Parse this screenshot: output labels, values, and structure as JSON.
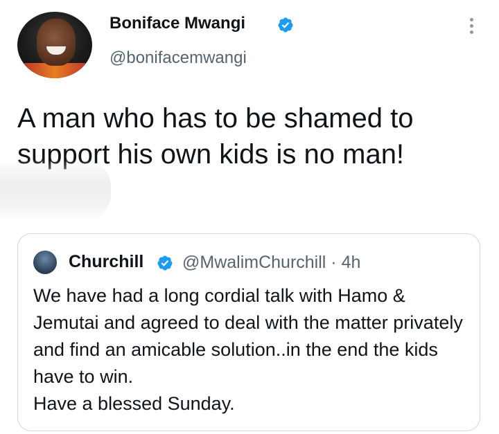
{
  "tweet": {
    "author": {
      "name": "Boniface Mwangi",
      "handle": "@bonifacemwangi",
      "verified": true
    },
    "text": "A man who has to be shamed to support his own kids is no man!"
  },
  "quoted_tweet": {
    "author": {
      "name": "Churchill",
      "handle": "@MwalimChurchill",
      "verified": true
    },
    "meta": "@MwalimChurchill · 4h",
    "text": "We have had a long cordial talk with Hamo & Jemutai and agreed to deal with the matter privately and find an amicable solution..in the end the kids have to win.\nHave a blessed Sunday."
  },
  "colors": {
    "verified_badge": "#1d9bf0",
    "secondary_text": "#536471",
    "border": "#cfd9de"
  },
  "icons": {
    "verified": "verified-badge-icon",
    "more": "more-options-icon"
  }
}
